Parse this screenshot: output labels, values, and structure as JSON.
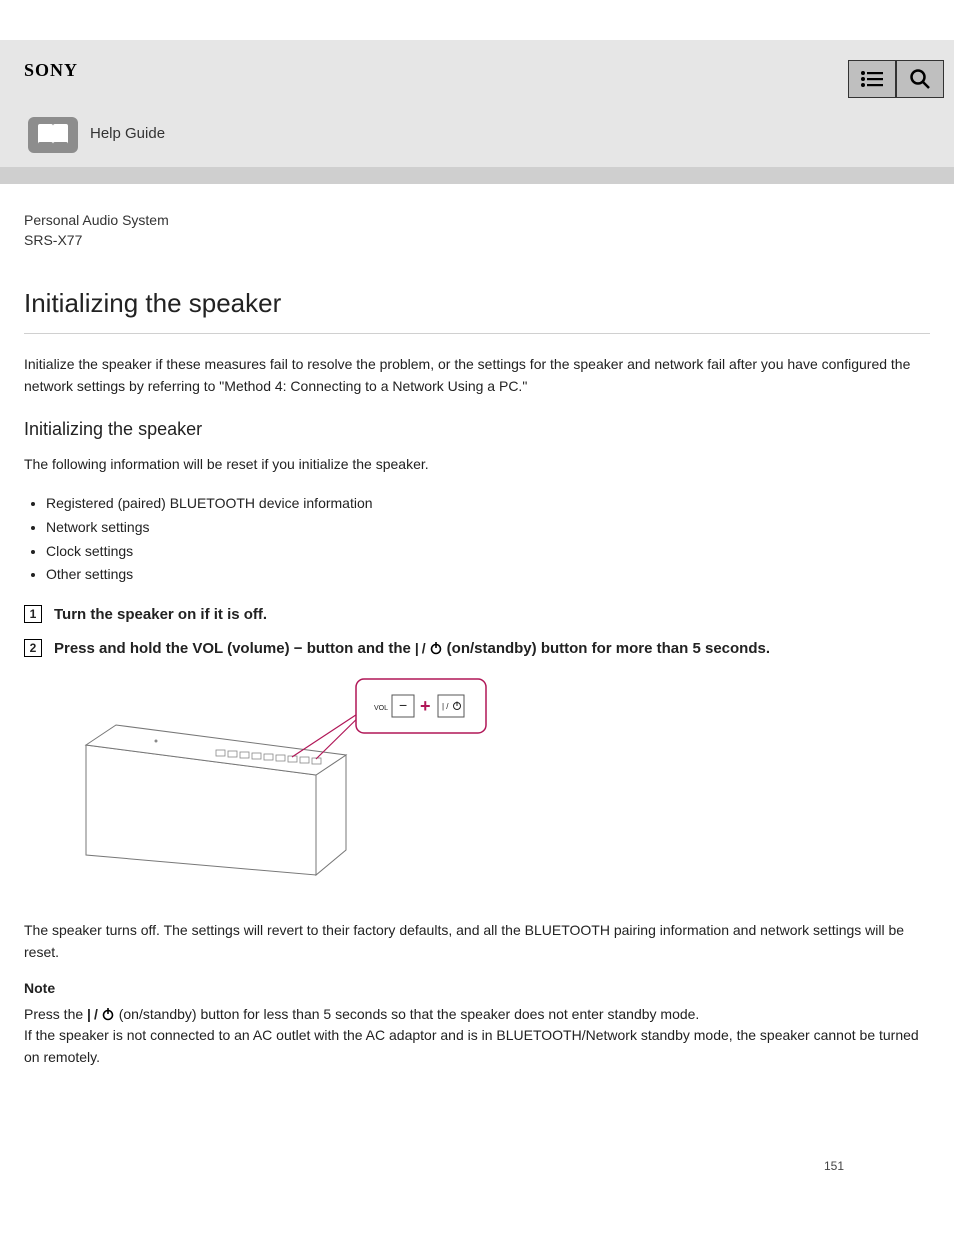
{
  "header": {
    "logo": "SONY",
    "guide_label": "Help Guide"
  },
  "content": {
    "product_line": "Personal Audio System",
    "model": "SRS-X77",
    "title": "Initializing the speaker",
    "intro": "Initialize the speaker if these measures fail to resolve the problem, or the settings for the speaker and network fail after you have configured the network settings by referring to \"Method 4: Connecting to a Network Using a PC.\"",
    "section_heading": "Initializing the speaker",
    "reset_intro": "The following information will be reset if you initialize the speaker.",
    "bullets": [
      "Registered (paired) BLUETOOTH device information",
      "Network settings",
      "Clock settings",
      "Other settings"
    ],
    "power_on_step": "Turn the speaker on if it is off.",
    "step2_a": "Press and hold the VOL (volume) − button and the ",
    "step2_b": " (on/standby) button for more than 5 seconds.",
    "after_init": "The speaker turns off. The settings will revert to their factory defaults, and all the BLUETOOTH pairing information and network settings will be reset.",
    "note_label": "Note",
    "note_a": "Press the ",
    "note_b": " (on/standby) button for less than 5 seconds so that the speaker does not enter standby mode.",
    "note_c": "If the speaker is not connected to an AC outlet with the AC adaptor and is in BLUETOOTH/Network standby mode, the speaker cannot be turned on remotely."
  },
  "illustration": {
    "callout_vol": "VOL",
    "callout_minus": "−",
    "callout_plus": "+"
  },
  "page_number": "151"
}
